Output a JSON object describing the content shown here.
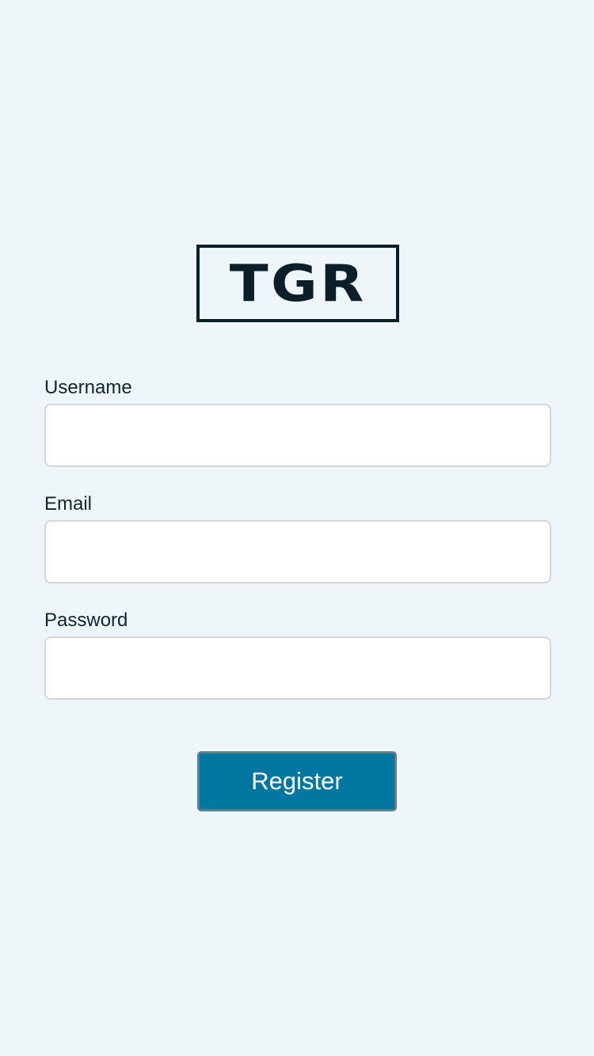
{
  "logo": {
    "text": "TGR"
  },
  "form": {
    "username": {
      "label": "Username",
      "value": "",
      "placeholder": ""
    },
    "email": {
      "label": "Email",
      "value": "",
      "placeholder": ""
    },
    "password": {
      "label": "Password",
      "value": "",
      "placeholder": ""
    },
    "submit_label": "Register"
  },
  "colors": {
    "background": "#eff6fa",
    "brand_dark": "#0b1f29",
    "button": "#0077a1",
    "input_border": "#d3d7da"
  }
}
